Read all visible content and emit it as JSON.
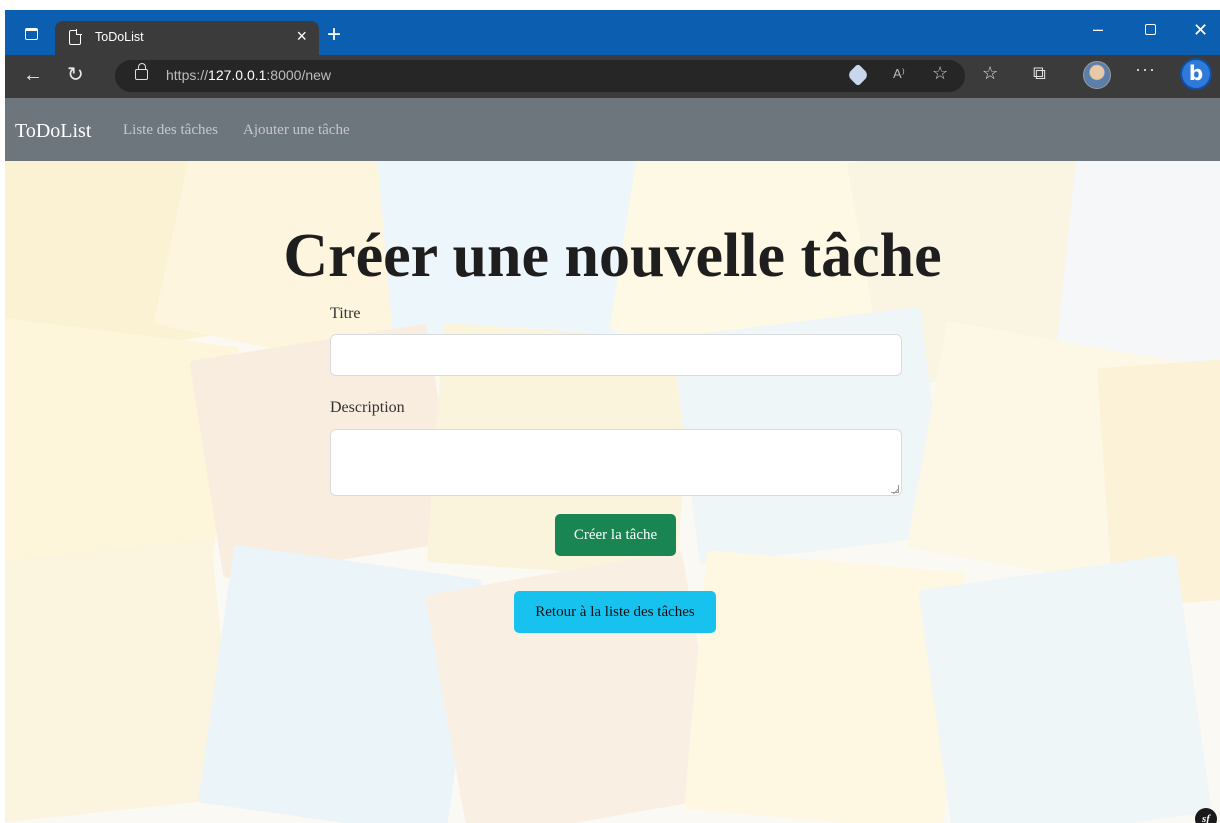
{
  "browser": {
    "tab_title": "ToDoList",
    "tab_close": "×",
    "new_tab": "+",
    "url_scheme": "https://",
    "url_host": "127.0.0.1",
    "url_rest": ":8000/new",
    "minimize": "–",
    "close": "✕",
    "more": "···",
    "read_aloud": "A⁾",
    "bing": "b"
  },
  "navbar": {
    "brand": "ToDoList",
    "links": [
      "Liste des tâches",
      "Ajouter une tâche"
    ]
  },
  "form": {
    "heading": "Créer une nouvelle tâche",
    "title_label": "Titre",
    "title_value": "",
    "description_label": "Description",
    "description_value": "",
    "submit_label": "Créer la tâche",
    "back_label": "Retour à la liste des tâches"
  },
  "footer": {
    "symfony_logo": "sf"
  },
  "colors": {
    "titlebar": "#0c5fb0",
    "navbar": "#6d757d",
    "submit": "#198553",
    "back": "#17c3ee"
  }
}
